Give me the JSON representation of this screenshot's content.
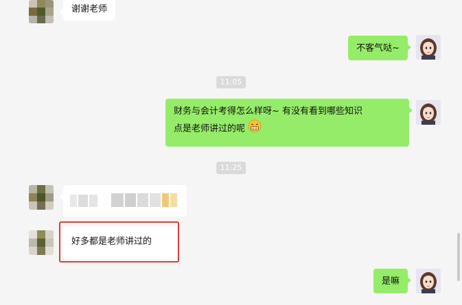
{
  "colors": {
    "background": "#f5f5f5",
    "out_bubble": "#95ec69",
    "in_bubble": "#ffffff",
    "highlight": "#e53935",
    "timestamp_bg": "#dadada"
  },
  "messages": [
    {
      "id": "m1",
      "side": "incoming",
      "text": "谢谢老师"
    },
    {
      "id": "m2",
      "side": "outgoing",
      "text": "不客气哒~"
    },
    {
      "id": "m3",
      "side": "outgoing",
      "text_line1": "财务与会计考得怎么样呀~ 有没有看到哪些知识",
      "text_line2": "点是老师讲过的呢",
      "emoji": "grinning-face-icon"
    },
    {
      "id": "m4",
      "side": "incoming",
      "text": "",
      "blurred": true
    },
    {
      "id": "m5",
      "side": "incoming",
      "text": "好多都是老师讲过的",
      "highlighted": true
    },
    {
      "id": "m6",
      "side": "outgoing",
      "text": "是嘛"
    }
  ],
  "timestamps": [
    "11:05",
    "11:25"
  ]
}
